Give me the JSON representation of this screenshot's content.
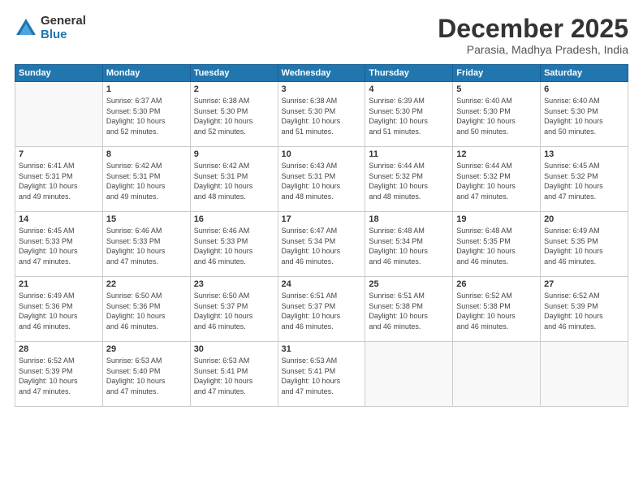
{
  "logo": {
    "general": "General",
    "blue": "Blue"
  },
  "title": "December 2025",
  "location": "Parasia, Madhya Pradesh, India",
  "days_header": [
    "Sunday",
    "Monday",
    "Tuesday",
    "Wednesday",
    "Thursday",
    "Friday",
    "Saturday"
  ],
  "weeks": [
    [
      {
        "num": "",
        "info": ""
      },
      {
        "num": "1",
        "info": "Sunrise: 6:37 AM\nSunset: 5:30 PM\nDaylight: 10 hours\nand 52 minutes."
      },
      {
        "num": "2",
        "info": "Sunrise: 6:38 AM\nSunset: 5:30 PM\nDaylight: 10 hours\nand 52 minutes."
      },
      {
        "num": "3",
        "info": "Sunrise: 6:38 AM\nSunset: 5:30 PM\nDaylight: 10 hours\nand 51 minutes."
      },
      {
        "num": "4",
        "info": "Sunrise: 6:39 AM\nSunset: 5:30 PM\nDaylight: 10 hours\nand 51 minutes."
      },
      {
        "num": "5",
        "info": "Sunrise: 6:40 AM\nSunset: 5:30 PM\nDaylight: 10 hours\nand 50 minutes."
      },
      {
        "num": "6",
        "info": "Sunrise: 6:40 AM\nSunset: 5:30 PM\nDaylight: 10 hours\nand 50 minutes."
      }
    ],
    [
      {
        "num": "7",
        "info": "Sunrise: 6:41 AM\nSunset: 5:31 PM\nDaylight: 10 hours\nand 49 minutes."
      },
      {
        "num": "8",
        "info": "Sunrise: 6:42 AM\nSunset: 5:31 PM\nDaylight: 10 hours\nand 49 minutes."
      },
      {
        "num": "9",
        "info": "Sunrise: 6:42 AM\nSunset: 5:31 PM\nDaylight: 10 hours\nand 48 minutes."
      },
      {
        "num": "10",
        "info": "Sunrise: 6:43 AM\nSunset: 5:31 PM\nDaylight: 10 hours\nand 48 minutes."
      },
      {
        "num": "11",
        "info": "Sunrise: 6:44 AM\nSunset: 5:32 PM\nDaylight: 10 hours\nand 48 minutes."
      },
      {
        "num": "12",
        "info": "Sunrise: 6:44 AM\nSunset: 5:32 PM\nDaylight: 10 hours\nand 47 minutes."
      },
      {
        "num": "13",
        "info": "Sunrise: 6:45 AM\nSunset: 5:32 PM\nDaylight: 10 hours\nand 47 minutes."
      }
    ],
    [
      {
        "num": "14",
        "info": "Sunrise: 6:45 AM\nSunset: 5:33 PM\nDaylight: 10 hours\nand 47 minutes."
      },
      {
        "num": "15",
        "info": "Sunrise: 6:46 AM\nSunset: 5:33 PM\nDaylight: 10 hours\nand 47 minutes."
      },
      {
        "num": "16",
        "info": "Sunrise: 6:46 AM\nSunset: 5:33 PM\nDaylight: 10 hours\nand 46 minutes."
      },
      {
        "num": "17",
        "info": "Sunrise: 6:47 AM\nSunset: 5:34 PM\nDaylight: 10 hours\nand 46 minutes."
      },
      {
        "num": "18",
        "info": "Sunrise: 6:48 AM\nSunset: 5:34 PM\nDaylight: 10 hours\nand 46 minutes."
      },
      {
        "num": "19",
        "info": "Sunrise: 6:48 AM\nSunset: 5:35 PM\nDaylight: 10 hours\nand 46 minutes."
      },
      {
        "num": "20",
        "info": "Sunrise: 6:49 AM\nSunset: 5:35 PM\nDaylight: 10 hours\nand 46 minutes."
      }
    ],
    [
      {
        "num": "21",
        "info": "Sunrise: 6:49 AM\nSunset: 5:36 PM\nDaylight: 10 hours\nand 46 minutes."
      },
      {
        "num": "22",
        "info": "Sunrise: 6:50 AM\nSunset: 5:36 PM\nDaylight: 10 hours\nand 46 minutes."
      },
      {
        "num": "23",
        "info": "Sunrise: 6:50 AM\nSunset: 5:37 PM\nDaylight: 10 hours\nand 46 minutes."
      },
      {
        "num": "24",
        "info": "Sunrise: 6:51 AM\nSunset: 5:37 PM\nDaylight: 10 hours\nand 46 minutes."
      },
      {
        "num": "25",
        "info": "Sunrise: 6:51 AM\nSunset: 5:38 PM\nDaylight: 10 hours\nand 46 minutes."
      },
      {
        "num": "26",
        "info": "Sunrise: 6:52 AM\nSunset: 5:38 PM\nDaylight: 10 hours\nand 46 minutes."
      },
      {
        "num": "27",
        "info": "Sunrise: 6:52 AM\nSunset: 5:39 PM\nDaylight: 10 hours\nand 46 minutes."
      }
    ],
    [
      {
        "num": "28",
        "info": "Sunrise: 6:52 AM\nSunset: 5:39 PM\nDaylight: 10 hours\nand 47 minutes."
      },
      {
        "num": "29",
        "info": "Sunrise: 6:53 AM\nSunset: 5:40 PM\nDaylight: 10 hours\nand 47 minutes."
      },
      {
        "num": "30",
        "info": "Sunrise: 6:53 AM\nSunset: 5:41 PM\nDaylight: 10 hours\nand 47 minutes."
      },
      {
        "num": "31",
        "info": "Sunrise: 6:53 AM\nSunset: 5:41 PM\nDaylight: 10 hours\nand 47 minutes."
      },
      {
        "num": "",
        "info": ""
      },
      {
        "num": "",
        "info": ""
      },
      {
        "num": "",
        "info": ""
      }
    ]
  ]
}
